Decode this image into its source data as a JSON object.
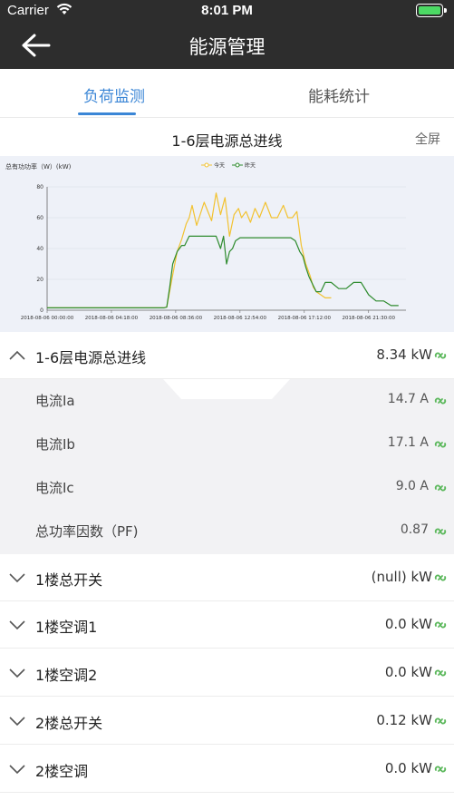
{
  "status_bar": {
    "carrier": "Carrier",
    "time": "8:01 PM"
  },
  "nav": {
    "title": "能源管理"
  },
  "tabs": [
    {
      "label": "负荷监测",
      "active": true
    },
    {
      "label": "能耗统计",
      "active": false
    }
  ],
  "chart_header": {
    "title": "1-6层电源总进线",
    "fullscreen": "全屏"
  },
  "chart_data": {
    "type": "line",
    "ylabel": "总有功功率（W）(kW)",
    "ylim": [
      0,
      80
    ],
    "yticks": [
      0,
      20,
      40,
      60,
      80
    ],
    "xtick_labels": [
      "2018-08-06 00:00:00",
      "2018-08-06 04:18:00",
      "2018-08-06 08:36:00",
      "2018-08-06 12:54:00",
      "2018-08-06 17:12:00",
      "2018-08-06 21:30:00"
    ],
    "x_hours": [
      0,
      4.3,
      8.6,
      12.9,
      17.2,
      21.5
    ],
    "series": [
      {
        "name": "今天",
        "color": "#f2c230",
        "x": [
          0,
          7.8,
          8.0,
          8.3,
          8.7,
          9.0,
          9.3,
          9.5,
          9.7,
          10.0,
          10.5,
          11.0,
          11.3,
          11.6,
          11.9,
          12.2,
          12.5,
          12.8,
          13.0,
          13.3,
          13.6,
          13.9,
          14.2,
          14.6,
          15.0,
          15.4,
          15.8,
          16.1,
          16.4,
          16.7,
          17.0,
          17.3,
          17.6,
          17.8,
          18.0,
          18.3,
          18.6,
          19.0
        ],
        "y": [
          1.5,
          1.5,
          2.0,
          18,
          38,
          46,
          56,
          60,
          68,
          55,
          70,
          58,
          76,
          62,
          73,
          48,
          62,
          66,
          60,
          64,
          57,
          66,
          60,
          70,
          60,
          60,
          68,
          60,
          60,
          64,
          42,
          30,
          22,
          15,
          12,
          10,
          8,
          8
        ]
      },
      {
        "name": "昨天",
        "color": "#2e8b2e",
        "x": [
          0,
          7.8,
          8.0,
          8.2,
          8.4,
          8.7,
          9.0,
          9.2,
          9.5,
          10.0,
          10.5,
          11.0,
          11.3,
          11.6,
          11.8,
          12.0,
          12.2,
          12.4,
          12.6,
          12.9,
          13.2,
          13.6,
          14.0,
          14.5,
          15.0,
          15.5,
          16.0,
          16.3,
          16.6,
          16.9,
          17.1,
          17.3,
          17.5,
          17.7,
          18.0,
          18.3,
          18.6,
          19.0,
          19.5,
          20.0,
          20.5,
          21.0,
          21.5,
          22.0,
          22.5,
          23.0,
          23.5
        ],
        "y": [
          1.5,
          1.5,
          2,
          15,
          30,
          38,
          42,
          42,
          48,
          48,
          48,
          48,
          48,
          40,
          48,
          30,
          38,
          40,
          45,
          47,
          47,
          47,
          47,
          47,
          47,
          47,
          47,
          47,
          45,
          38,
          35,
          28,
          22,
          18,
          12,
          12,
          18,
          18,
          14,
          14,
          18,
          18,
          10,
          6,
          6,
          3,
          3
        ]
      }
    ]
  },
  "main_item": {
    "label": "1-6层电源总进线",
    "value": "8.34 kW"
  },
  "sub_items": [
    {
      "label": "电流Ia",
      "value": "14.7 A"
    },
    {
      "label": "电流Ib",
      "value": "17.1 A"
    },
    {
      "label": "电流Ic",
      "value": "9.0 A"
    },
    {
      "label": "总功率因数（PF)",
      "value": "0.87"
    }
  ],
  "list_items": [
    {
      "label": "1楼总开关",
      "value": "(null) kW"
    },
    {
      "label": "1楼空调1",
      "value": "0.0 kW"
    },
    {
      "label": "1楼空调2",
      "value": "0.0 kW"
    },
    {
      "label": "2楼总开关",
      "value": "0.12 kW"
    },
    {
      "label": "2楼空调",
      "value": "0.0 kW"
    }
  ],
  "colors": {
    "accent": "#3b86d6",
    "nav_bg": "#2d2d2d",
    "link_icon": "#5cb85c",
    "chart_bg": "#eef1f8"
  }
}
